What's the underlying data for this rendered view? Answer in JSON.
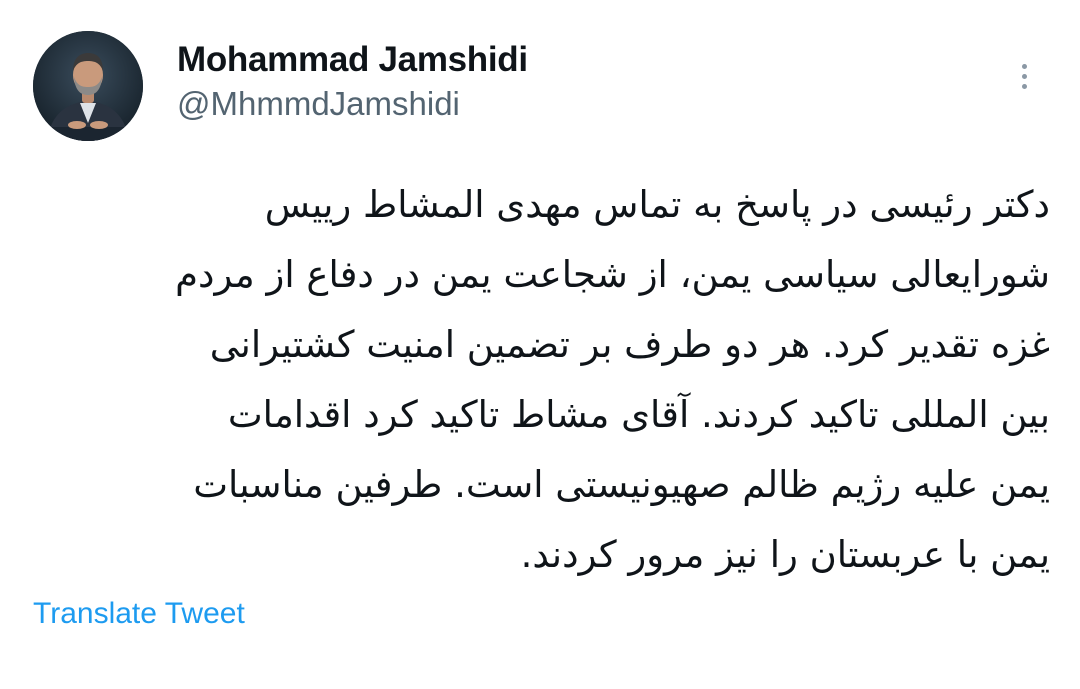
{
  "tweet": {
    "author": {
      "display_name": "Mohammad Jamshidi",
      "handle": "@MhmmdJamshidi",
      "avatar_icon": "profile-photo"
    },
    "more_icon": "more-vertical-icon",
    "text_lines": [
      "دکتر رئیسی در پاسخ به تماس مهدی المشاط رییس",
      "شورایعالی سیاسی یمن، از شجاعت یمن در دفاع از مردم",
      "غزه تقدیر کرد. هر دو طرف بر تضمین امنیت کشتیرانی",
      "بین المللی تاکید کردند. آقای مشاط تاکید کرد اقدامات",
      "یمن علیه رژیم ظالم صهیونیستی است. طرفین مناسبات",
      "یمن با عربستان را نیز مرور کردند."
    ],
    "translate_label": "Translate Tweet",
    "colors": {
      "name": "#0f1419",
      "handle": "#536471",
      "link": "#1d9bf0",
      "icon": "#8b98a5"
    }
  }
}
